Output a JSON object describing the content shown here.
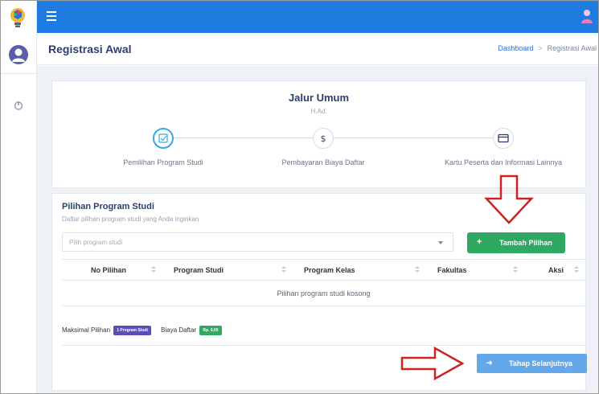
{
  "header": {
    "title": "Registrasi Awal",
    "breadcrumb": [
      "Dashboard",
      "Registrasi Awal"
    ]
  },
  "wizard": {
    "jalur": "Jalur Umum",
    "code": "H.Ad.",
    "steps": [
      {
        "label": "Pemilihan Program Studi",
        "icon": "checkbox-icon",
        "active": true
      },
      {
        "label": "Pembayaran Biaya Daftar",
        "icon": "dollar-icon",
        "active": false
      },
      {
        "label": "Kartu Peserta dan Informasi Lainnya",
        "icon": "card-icon",
        "active": false
      }
    ]
  },
  "pilihan": {
    "title": "Pilihan Program Studi",
    "subtitle": "Daftar pilihan program studi yang Anda inginkan",
    "select_placeholder": "Pilih program studi",
    "add_button": "Tambah Pilihan",
    "columns": [
      "No Pilihan",
      "Program Studi",
      "Program Kelas",
      "Fakultas",
      "Aksi"
    ],
    "empty_text": "Pilihan program studi kosong",
    "max_label": "Maksimal Pilihan",
    "max_value": "1 Program Studi",
    "fee_label": "Biaya Daftar",
    "fee_value": "Rp. 0,00",
    "next_button": "Tahap Selanjutnya"
  },
  "colors": {
    "topbar": "#1e7ce0",
    "add_button": "#2fa862",
    "next_button": "#64a8ea",
    "badge_purple": "#5a4fb8",
    "annotation_arrow": "#cc2222"
  }
}
